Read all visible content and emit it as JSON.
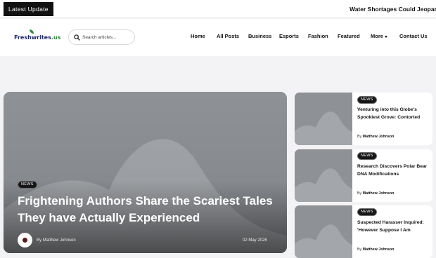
{
  "topbar": {
    "latest_label": "Latest Update",
    "ticker": "Water Shortages Could Jeopardize"
  },
  "logo": {
    "text_main": "Freshwrites",
    "text_tld": ".us"
  },
  "search": {
    "placeholder": "Search articles..."
  },
  "nav": {
    "items": [
      "Home",
      "All Posts",
      "Business",
      "Esports",
      "Fashion",
      "Featured",
      "More",
      "Contact Us"
    ]
  },
  "hero": {
    "category": "NEWS",
    "title": "Frightening Authors Share the Scariest Tales They have Actually Experienced",
    "author_prefix": "By",
    "author": "Matthew Johnson",
    "date": "02 May 2026"
  },
  "cards": [
    {
      "category": "NEWS",
      "title": "Venturing into this Globe's Spookiest Grove: Contorted",
      "author_prefix": "By",
      "author": "Matthew Johnson"
    },
    {
      "category": "NEWS",
      "title": "Research Discovers Polar Bear DNA Modifications",
      "author_prefix": "By",
      "author": "Matthew Johnson"
    },
    {
      "category": "NEWS",
      "title": "Suspected Harasser Inquired: 'However Suppose I Am",
      "author_prefix": "By",
      "author": "Matthew Johnson"
    }
  ],
  "colors": {
    "brand_navy": "#1f2a6d",
    "brand_green": "#2f8b3c",
    "placeholder_gray": "#8e9196"
  }
}
